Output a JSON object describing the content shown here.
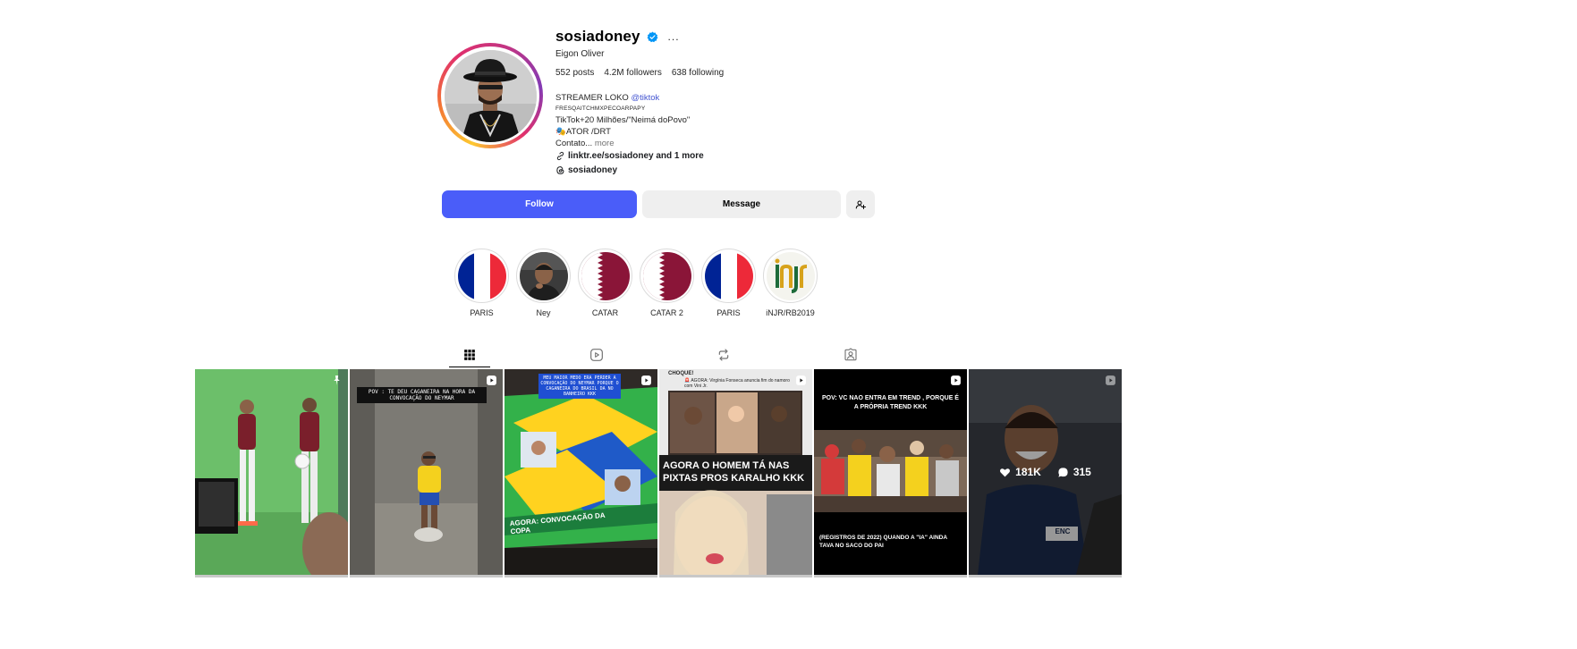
{
  "profile": {
    "username": "sosiadoney",
    "more_icon": "...",
    "full_name": "Eigon Oliver",
    "stats": {
      "posts": "552 posts",
      "followers": "4.2M followers",
      "following": "638 following"
    },
    "bio": {
      "line1_text": "STREAMER LOKO ",
      "line1_mention": "@tiktok",
      "line2": "FRESQAITCHMXPECOARPAPY",
      "line3": "TikTok+20 Milhões/\"Neimá doPovo\"",
      "line4": "🎭ATOR /DRT",
      "line5_text": "Contato... ",
      "line5_more": "more"
    },
    "link": "linktr.ee/sosiadoney and 1 more",
    "threads": "sosiadoney"
  },
  "actions": {
    "follow_label": "Follow",
    "message_label": "Message"
  },
  "highlights": [
    {
      "label": "PARIS",
      "kind": "france"
    },
    {
      "label": "Ney",
      "kind": "photo"
    },
    {
      "label": "CATAR",
      "kind": "qatar"
    },
    {
      "label": "CATAR 2",
      "kind": "qatar"
    },
    {
      "label": "PARIS",
      "kind": "france"
    },
    {
      "label": "iNJR/RB2019",
      "kind": "logo"
    }
  ],
  "colors": {
    "accent": "#4a5df9",
    "verified": "#0095f6",
    "france_blue": "#002395",
    "france_red": "#ed2939",
    "qatar": "#8a1538"
  },
  "posts": {
    "p2_caption": "POV : TE DEU CAGANEIRA NA HORA DA CONVOCAÇÃO DO NEYMAR",
    "p3_caption": "MEU MAIOR MEDO ERA PERDER A CONVOCAÇÃO DO NEYMAR PORQUE O CAGANEIRA DO BRASIL DA NO BANHEIRO KKK",
    "p3_banner": "AGORA: CONVOCAÇÃO DA COPA",
    "p4_header": "CHOQUE!",
    "p4_news": "🚨 AGORA: Virgínia Fonseca anuncia fim do namoro com Vini Jr.",
    "p4_caption": "AGORA O HOMEM TÁ NAS PIXTAS PROS KARALHO KKK",
    "p5_top": "POV: VC NAO ENTRA EM TREND , PORQUE É A PRÓPRIA TREND KKK",
    "p5_bottom": "(REGISTROS DE 2022) QUANDO A \"IA\" AINDA TAVA NO SACO DO PAI",
    "p6_likes": "181K",
    "p6_comments": "315",
    "p6_jersey": "ENC"
  }
}
